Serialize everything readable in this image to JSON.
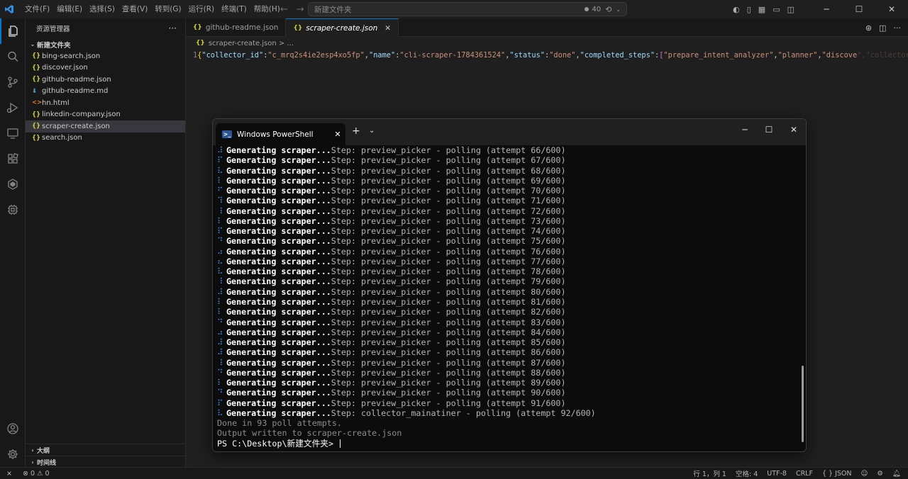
{
  "titlebar": {
    "menu": [
      "文件(F)",
      "编辑(E)",
      "选择(S)",
      "查看(V)",
      "转到(G)",
      "运行(R)",
      "终端(T)",
      "帮助(H)"
    ],
    "command_center_title": "新建文件夹",
    "copilot_count": "40"
  },
  "sidebar": {
    "title": "资源管理器",
    "folder_name": "新建文件夹",
    "files": [
      {
        "name": "bing-search.json",
        "type": "json"
      },
      {
        "name": "discover.json",
        "type": "json"
      },
      {
        "name": "github-readme.json",
        "type": "json"
      },
      {
        "name": "github-readme.md",
        "type": "md"
      },
      {
        "name": "hn.html",
        "type": "html"
      },
      {
        "name": "linkedin-company.json",
        "type": "json"
      },
      {
        "name": "scraper-create.json",
        "type": "json",
        "selected": true
      },
      {
        "name": "search.json",
        "type": "json"
      }
    ],
    "outline_label": "大纲",
    "timeline_label": "时间线"
  },
  "editor": {
    "tabs": [
      {
        "label": "github-readme.json",
        "active": false
      },
      {
        "label": "scraper-create.json",
        "active": true
      }
    ],
    "breadcrumb": "scraper-create.json > ...",
    "line_number": "1",
    "code": {
      "k1": "\"collector_id\"",
      "v1": "\"c_mrq2s4ie2esp4xo5fp\"",
      "k2": "\"name\"",
      "v2": "\"cli-scraper-1784361524\"",
      "k3": "\"status\"",
      "v3": "\"done\"",
      "k4": "\"completed_steps\"",
      "a1": "\"prepare_intent_analyzer\"",
      "a2": "\"planner\"",
      "a3": "\"discove",
      "tail": "\",\"collector_..."
    }
  },
  "terminal": {
    "tab_label": "Windows PowerShell",
    "progress_prefix": "Generating scraper...",
    "lines": [
      {
        "spinner": "⠼",
        "step": "Step: preview_picker - polling (attempt 66/600)"
      },
      {
        "spinner": "⠏",
        "step": "Step: preview_picker - polling (attempt 67/600)"
      },
      {
        "spinner": "⠧",
        "step": "Step: preview_picker - polling (attempt 68/600)"
      },
      {
        "spinner": "⠇",
        "step": "Step: preview_picker - polling (attempt 69/600)"
      },
      {
        "spinner": "⠋",
        "step": "Step: preview_picker - polling (attempt 70/600)"
      },
      {
        "spinner": "⠹",
        "step": "Step: preview_picker - polling (attempt 71/600)"
      },
      {
        "spinner": "⠸",
        "step": "Step: preview_picker - polling (attempt 72/600)"
      },
      {
        "spinner": "⠇",
        "step": "Step: preview_picker - polling (attempt 73/600)"
      },
      {
        "spinner": "⠏",
        "step": "Step: preview_picker - polling (attempt 74/600)"
      },
      {
        "spinner": "⠙",
        "step": "Step: preview_picker - polling (attempt 75/600)"
      },
      {
        "spinner": "⠴",
        "step": "Step: preview_picker - polling (attempt 76/600)"
      },
      {
        "spinner": "⠦",
        "step": "Step: preview_picker - polling (attempt 77/600)"
      },
      {
        "spinner": "⠧",
        "step": "Step: preview_picker - polling (attempt 78/600)"
      },
      {
        "spinner": "⠸",
        "step": "Step: preview_picker - polling (attempt 79/600)"
      },
      {
        "spinner": "⠼",
        "step": "Step: preview_picker - polling (attempt 80/600)"
      },
      {
        "spinner": "⠇",
        "step": "Step: preview_picker - polling (attempt 81/600)"
      },
      {
        "spinner": "⠇",
        "step": "Step: preview_picker - polling (attempt 82/600)"
      },
      {
        "spinner": "⠙",
        "step": "Step: preview_picker - polling (attempt 83/600)"
      },
      {
        "spinner": "⠴",
        "step": "Step: preview_picker - polling (attempt 84/600)"
      },
      {
        "spinner": "⠼",
        "step": "Step: preview_picker - polling (attempt 85/600)"
      },
      {
        "spinner": "⠼",
        "step": "Step: preview_picker - polling (attempt 86/600)"
      },
      {
        "spinner": "⠸",
        "step": "Step: preview_picker - polling (attempt 87/600)"
      },
      {
        "spinner": "⠙",
        "step": "Step: preview_picker - polling (attempt 88/600)"
      },
      {
        "spinner": "⠇",
        "step": "Step: preview_picker - polling (attempt 89/600)"
      },
      {
        "spinner": "⠙",
        "step": "Step: preview_picker - polling (attempt 90/600)"
      },
      {
        "spinner": "⠏",
        "step": "Step: preview_picker - polling (attempt 91/600)"
      },
      {
        "spinner": "⠧",
        "step": "Step: collector_mainatiner - polling (attempt 92/600)"
      }
    ],
    "done_line": "Done in 93 poll attempts.",
    "output_line": "Output written to scraper-create.json",
    "prompt": "PS C:\\Desktop\\新建文件夹> "
  },
  "statusbar": {
    "errors": "0",
    "warnings": "0",
    "position": "行 1，列 1",
    "spaces": "空格: 4",
    "encoding": "UTF-8",
    "eol": "CRLF",
    "language": "JSON"
  },
  "colors": {
    "accent": "#0078d4",
    "terminal_bg": "#0c0c0c",
    "spinner": "#3b8eea"
  }
}
